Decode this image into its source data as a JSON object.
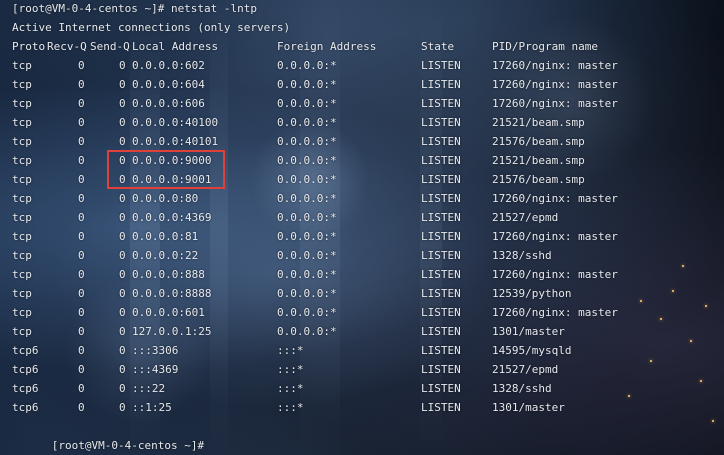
{
  "terminal": {
    "command_line": "[root@VM-0-4-centos ~]# netstat -lntp",
    "info_line": "Active Internet connections (only servers)",
    "header": {
      "proto": "Proto",
      "recv_q": "Recv-Q",
      "send_q": "Send-Q",
      "local": "Local Address",
      "foreign": "Foreign Address",
      "state": "State",
      "pid": "PID/Program name"
    },
    "rows": [
      {
        "proto": "tcp",
        "recv": "0",
        "send": "0",
        "local": "0.0.0.0:602",
        "foreign": "0.0.0.0:*",
        "state": "LISTEN",
        "pid": "17260/nginx: master"
      },
      {
        "proto": "tcp",
        "recv": "0",
        "send": "0",
        "local": "0.0.0.0:604",
        "foreign": "0.0.0.0:*",
        "state": "LISTEN",
        "pid": "17260/nginx: master"
      },
      {
        "proto": "tcp",
        "recv": "0",
        "send": "0",
        "local": "0.0.0.0:606",
        "foreign": "0.0.0.0:*",
        "state": "LISTEN",
        "pid": "17260/nginx: master"
      },
      {
        "proto": "tcp",
        "recv": "0",
        "send": "0",
        "local": "0.0.0.0:40100",
        "foreign": "0.0.0.0:*",
        "state": "LISTEN",
        "pid": "21521/beam.smp"
      },
      {
        "proto": "tcp",
        "recv": "0",
        "send": "0",
        "local": "0.0.0.0:40101",
        "foreign": "0.0.0.0:*",
        "state": "LISTEN",
        "pid": "21576/beam.smp"
      },
      {
        "proto": "tcp",
        "recv": "0",
        "send": "0",
        "local": "0.0.0.0:9000",
        "foreign": "0.0.0.0:*",
        "state": "LISTEN",
        "pid": "21521/beam.smp"
      },
      {
        "proto": "tcp",
        "recv": "0",
        "send": "0",
        "local": "0.0.0.0:9001",
        "foreign": "0.0.0.0:*",
        "state": "LISTEN",
        "pid": "21576/beam.smp"
      },
      {
        "proto": "tcp",
        "recv": "0",
        "send": "0",
        "local": "0.0.0.0:80",
        "foreign": "0.0.0.0:*",
        "state": "LISTEN",
        "pid": "17260/nginx: master"
      },
      {
        "proto": "tcp",
        "recv": "0",
        "send": "0",
        "local": "0.0.0.0:4369",
        "foreign": "0.0.0.0:*",
        "state": "LISTEN",
        "pid": "21527/epmd"
      },
      {
        "proto": "tcp",
        "recv": "0",
        "send": "0",
        "local": "0.0.0.0:81",
        "foreign": "0.0.0.0:*",
        "state": "LISTEN",
        "pid": "17260/nginx: master"
      },
      {
        "proto": "tcp",
        "recv": "0",
        "send": "0",
        "local": "0.0.0.0:22",
        "foreign": "0.0.0.0:*",
        "state": "LISTEN",
        "pid": "1328/sshd"
      },
      {
        "proto": "tcp",
        "recv": "0",
        "send": "0",
        "local": "0.0.0.0:888",
        "foreign": "0.0.0.0:*",
        "state": "LISTEN",
        "pid": "17260/nginx: master"
      },
      {
        "proto": "tcp",
        "recv": "0",
        "send": "0",
        "local": "0.0.0.0:8888",
        "foreign": "0.0.0.0:*",
        "state": "LISTEN",
        "pid": "12539/python"
      },
      {
        "proto": "tcp",
        "recv": "0",
        "send": "0",
        "local": "0.0.0.0:601",
        "foreign": "0.0.0.0:*",
        "state": "LISTEN",
        "pid": "17260/nginx: master"
      },
      {
        "proto": "tcp",
        "recv": "0",
        "send": "0",
        "local": "127.0.0.1:25",
        "foreign": "0.0.0.0:*",
        "state": "LISTEN",
        "pid": "1301/master"
      },
      {
        "proto": "tcp6",
        "recv": "0",
        "send": "0",
        "local": ":::3306",
        "foreign": ":::*",
        "state": "LISTEN",
        "pid": "14595/mysqld"
      },
      {
        "proto": "tcp6",
        "recv": "0",
        "send": "0",
        "local": ":::4369",
        "foreign": ":::*",
        "state": "LISTEN",
        "pid": "21527/epmd"
      },
      {
        "proto": "tcp6",
        "recv": "0",
        "send": "0",
        "local": ":::22",
        "foreign": ":::*",
        "state": "LISTEN",
        "pid": "1328/sshd"
      },
      {
        "proto": "tcp6",
        "recv": "0",
        "send": "0",
        "local": "::1:25",
        "foreign": ":::*",
        "state": "LISTEN",
        "pid": "1301/master"
      }
    ],
    "prompt": "[root@VM-0-4-centos ~]#"
  },
  "colors": {
    "text": "#e6e9ee",
    "highlight": "#e0403a",
    "cursor": "#3cc77a"
  }
}
